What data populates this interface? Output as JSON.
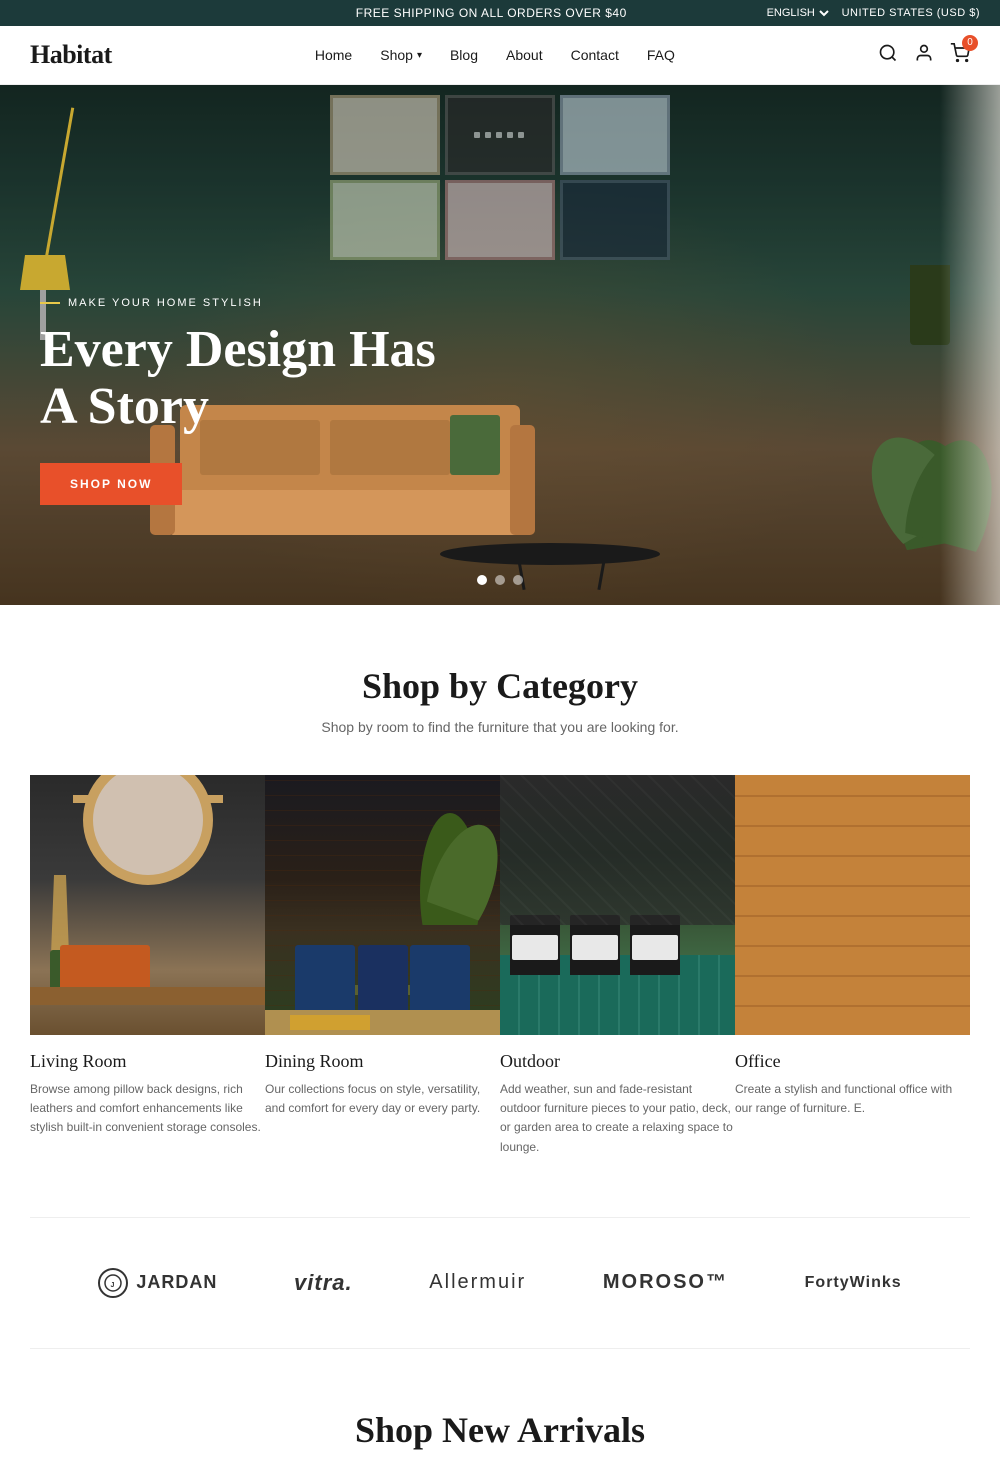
{
  "topBar": {
    "shipping_text": "FREE SHIPPING ON ALL ORDERS OVER $40",
    "language": "ENGLISH",
    "currency": "UNITED STATES (USD $)"
  },
  "header": {
    "logo": "Habitat",
    "nav": [
      {
        "label": "Home",
        "has_dropdown": false
      },
      {
        "label": "Shop",
        "has_dropdown": true
      },
      {
        "label": "Blog",
        "has_dropdown": false
      },
      {
        "label": "About",
        "has_dropdown": false
      },
      {
        "label": "Contact",
        "has_dropdown": false
      },
      {
        "label": "FAQ",
        "has_dropdown": false
      }
    ],
    "cart_count": "0"
  },
  "hero": {
    "tagline": "MAKE YOUR HOME STYLISH",
    "title": "Every Design Has A Story",
    "cta_label": "SHOP NOW",
    "dots": [
      {
        "active": true
      },
      {
        "active": false
      },
      {
        "active": false
      }
    ]
  },
  "shopCategory": {
    "title": "Shop by Category",
    "subtitle": "Shop by room to find the furniture that you are looking for.",
    "categories": [
      {
        "name": "Living Room",
        "description": "Browse among pillow back designs, rich leathers and comfort enhancements like stylish built-in convenient storage consoles.",
        "type": "living"
      },
      {
        "name": "Dining Room",
        "description": "Our collections focus on style, versatility, and comfort for every day or every party.",
        "type": "dining"
      },
      {
        "name": "Outdoor",
        "description": "Add weather, sun and fade-resistant outdoor furniture pieces to your patio, deck, or garden area to create a relaxing space to lounge.",
        "type": "outdoor"
      },
      {
        "name": "Office",
        "description": "Create a stylish and functional office with our range of furniture. E.",
        "type": "office"
      }
    ]
  },
  "brands": [
    {
      "name": "JARDAN",
      "style": "jardan"
    },
    {
      "name": "vitra.",
      "style": "vitra"
    },
    {
      "name": "Allermuir",
      "style": "allermuir"
    },
    {
      "name": "MOROSO™",
      "style": "moroso"
    },
    {
      "name": "FortyWinks",
      "style": "fortywinks"
    }
  ],
  "newArrivals": {
    "title": "Shop New Arrivals"
  }
}
